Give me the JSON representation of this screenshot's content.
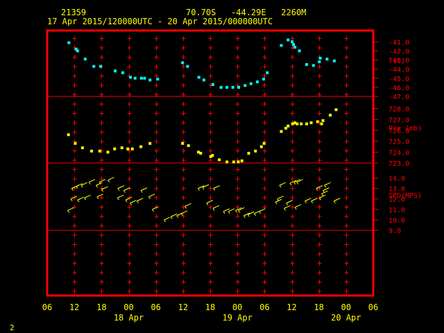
{
  "header": {
    "station": "21359",
    "location": "70.70S   -44.29E   2260M",
    "period": "17 Apr 2015/120000UTC - 20 Apr 2015/000000UTC"
  },
  "footer": {
    "page_number": "2"
  },
  "chart_data": {
    "type": "scatter",
    "x_axis": {
      "tick_labels": [
        "06",
        "12",
        "18",
        "00",
        "06",
        "12",
        "18",
        "00",
        "06",
        "12",
        "18",
        "00",
        "06"
      ],
      "tick_hours": [
        -18,
        -12,
        -6,
        0,
        6,
        12,
        18,
        24,
        30,
        36,
        42,
        48,
        54
      ],
      "date_labels": [
        {
          "text": "18 Apr",
          "hour": 0
        },
        {
          "text": "19 Apr",
          "hour": 24
        },
        {
          "text": "20 Apr",
          "hour": 48
        }
      ],
      "range_hours": [
        -18,
        54
      ],
      "hour_zero": "18 Apr 2015 00 UTC"
    },
    "panels": [
      {
        "name": "temperature",
        "label": "T(C)",
        "tick_labels": [
          "-41.0",
          "-42.0",
          "-43.0",
          "-44.0",
          "-45.0",
          "-46.0",
          "-47.0"
        ],
        "ylim": [
          -47,
          -40.6
        ],
        "color": "#00ffff",
        "points": [
          [
            -13.2,
            -41.1
          ],
          [
            -11.6,
            -41.8
          ],
          [
            -11.3,
            -42.0
          ],
          [
            -9.6,
            -42.9
          ],
          [
            -7.7,
            -43.7
          ],
          [
            -6.2,
            -43.7
          ],
          [
            -3.0,
            -44.2
          ],
          [
            -1.3,
            -44.4
          ],
          [
            0.4,
            -44.9
          ],
          [
            1.4,
            -45.0
          ],
          [
            2.8,
            -45.0
          ],
          [
            3.5,
            -45.0
          ],
          [
            4.7,
            -45.2
          ],
          [
            6.4,
            -45.1
          ],
          [
            11.9,
            -43.3
          ],
          [
            13.0,
            -43.7
          ],
          [
            15.5,
            -44.9
          ],
          [
            16.6,
            -45.2
          ],
          [
            18.6,
            -45.7
          ],
          [
            20.4,
            -46.0
          ],
          [
            21.7,
            -46.0
          ],
          [
            23.0,
            -46.0
          ],
          [
            24.3,
            -46.0
          ],
          [
            25.7,
            -45.8
          ],
          [
            27.0,
            -45.6
          ],
          [
            28.4,
            -45.4
          ],
          [
            29.8,
            -45.1
          ],
          [
            30.6,
            -44.4
          ],
          [
            33.7,
            -41.4
          ],
          [
            35.2,
            -40.8
          ],
          [
            36.1,
            -41.0
          ],
          [
            36.4,
            -41.3
          ],
          [
            36.7,
            -41.6
          ],
          [
            37.7,
            -42.0
          ],
          [
            39.3,
            -43.5
          ],
          [
            40.8,
            -43.6
          ],
          [
            42.1,
            -43.2
          ],
          [
            42.3,
            -42.8
          ],
          [
            43.8,
            -42.9
          ],
          [
            45.4,
            -43.1
          ]
        ]
      },
      {
        "name": "pressure",
        "label": "Pre (mb)",
        "tick_labels": [
          "728.0",
          "727.0",
          "726.0",
          "725.0",
          "724.0",
          "723.0"
        ],
        "ylim": [
          723,
          728.1
        ],
        "color": "#ffff00",
        "points": [
          [
            -13.3,
            725.6
          ],
          [
            -11.8,
            724.8
          ],
          [
            -10.2,
            724.4
          ],
          [
            -8.2,
            724.1
          ],
          [
            -6.4,
            724.1
          ],
          [
            -4.6,
            724.0
          ],
          [
            -3.1,
            724.3
          ],
          [
            -1.5,
            724.4
          ],
          [
            -0.2,
            724.3
          ],
          [
            0.8,
            724.3
          ],
          [
            2.7,
            724.5
          ],
          [
            4.7,
            724.8
          ],
          [
            11.9,
            724.8
          ],
          [
            13.2,
            724.6
          ],
          [
            15.4,
            724.0
          ],
          [
            15.9,
            723.9
          ],
          [
            18.1,
            723.6
          ],
          [
            18.5,
            723.7
          ],
          [
            20.0,
            723.3
          ],
          [
            21.7,
            723.1
          ],
          [
            23.2,
            723.1
          ],
          [
            24.2,
            723.1
          ],
          [
            25.0,
            723.2
          ],
          [
            26.5,
            723.9
          ],
          [
            28.0,
            724.1
          ],
          [
            29.3,
            724.5
          ],
          [
            29.9,
            724.8
          ],
          [
            33.7,
            725.9
          ],
          [
            34.7,
            726.2
          ],
          [
            35.2,
            726.4
          ],
          [
            36.2,
            726.6
          ],
          [
            36.7,
            726.7
          ],
          [
            37.2,
            726.6
          ],
          [
            38.1,
            726.6
          ],
          [
            39.3,
            726.6
          ],
          [
            40.3,
            726.7
          ],
          [
            41.7,
            726.8
          ],
          [
            42.6,
            726.6
          ],
          [
            42.9,
            726.9
          ],
          [
            44.5,
            727.4
          ],
          [
            45.8,
            727.9
          ]
        ]
      },
      {
        "name": "wind_speed",
        "label": "SPD(MPS)",
        "tick_labels": [
          "14.0",
          "13.0",
          "12.0",
          "11.0",
          "10.0",
          "9.0"
        ],
        "ylim": [
          9,
          14.3
        ],
        "color": "#ffff00",
        "points": [
          [
            -13.5,
            10.9
          ],
          [
            -12.8,
            12.0
          ],
          [
            -12.6,
            13.0
          ],
          [
            -11.6,
            13.2
          ],
          [
            -11.3,
            11.9
          ],
          [
            -10.5,
            13.3
          ],
          [
            -9.8,
            12.1
          ],
          [
            -8.8,
            13.6
          ],
          [
            -7.2,
            13.3
          ],
          [
            -7.0,
            12.2
          ],
          [
            -6.5,
            13.6
          ],
          [
            -6.0,
            12.9
          ],
          [
            -4.6,
            13.8
          ],
          [
            -2.5,
            12.1
          ],
          [
            -2.4,
            13.0
          ],
          [
            -1.1,
            12.8
          ],
          [
            -0.7,
            11.9
          ],
          [
            0.3,
            11.6
          ],
          [
            1.8,
            11.8
          ],
          [
            2.7,
            12.8
          ],
          [
            4.4,
            12.2
          ],
          [
            5.2,
            11.0
          ],
          [
            7.8,
            10.0
          ],
          [
            9.3,
            10.3
          ],
          [
            10.6,
            10.4
          ],
          [
            11.6,
            10.6
          ],
          [
            12.4,
            11.3
          ],
          [
            15.3,
            13.0
          ],
          [
            16.3,
            13.1
          ],
          [
            17.2,
            11.6
          ],
          [
            18.6,
            11.1
          ],
          [
            18.7,
            13.0
          ],
          [
            20.9,
            10.8
          ],
          [
            22.0,
            10.8
          ],
          [
            23.6,
            10.9
          ],
          [
            24.2,
            10.9
          ],
          [
            25.4,
            10.4
          ],
          [
            26.3,
            10.5
          ],
          [
            27.7,
            10.6
          ],
          [
            28.8,
            10.8
          ],
          [
            32.4,
            11.7
          ],
          [
            32.8,
            12.0
          ],
          [
            33.3,
            13.3
          ],
          [
            34.3,
            11.1
          ],
          [
            34.8,
            11.6
          ],
          [
            35.6,
            13.5
          ],
          [
            36.5,
            13.6
          ],
          [
            36.7,
            11.2
          ],
          [
            37.1,
            13.6
          ],
          [
            38.9,
            11.8
          ],
          [
            40.3,
            11.8
          ],
          [
            41.4,
            13.0
          ],
          [
            42.1,
            12.1
          ],
          [
            42.6,
            12.5
          ],
          [
            42.9,
            12.8
          ],
          [
            43.2,
            13.3
          ],
          [
            45.3,
            11.8
          ]
        ]
      }
    ]
  },
  "colors": {
    "frame": "#ff0000",
    "grid": "#ff0000",
    "text": "#ffff00",
    "label": "#ff0000",
    "temperature": "#00ffff",
    "pressure": "#ffff00",
    "wind": "#ffff00"
  }
}
